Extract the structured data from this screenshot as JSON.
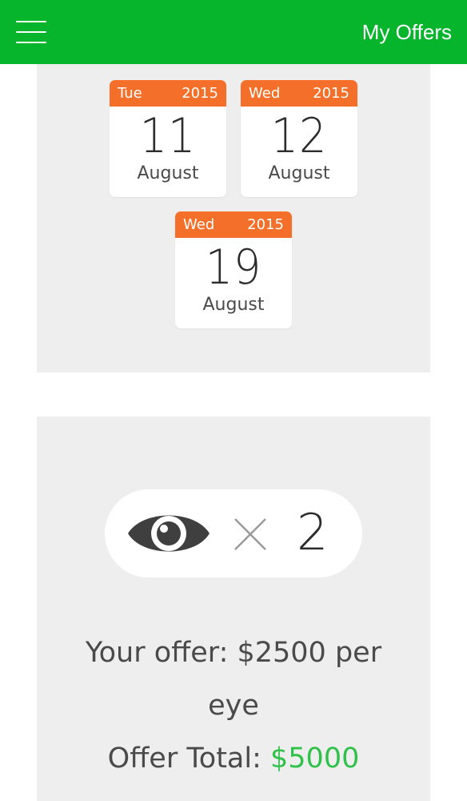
{
  "header": {
    "title": "My Offers",
    "menu_icon": "hamburger-menu-icon",
    "background_color": "#06b52b"
  },
  "dates": [
    {
      "weekday": "Tue",
      "year": "2015",
      "day": "11",
      "month": "August"
    },
    {
      "weekday": "Wed",
      "year": "2015",
      "day": "12",
      "month": "August"
    },
    {
      "weekday": "Wed",
      "year": "2015",
      "day": "19",
      "month": "August"
    }
  ],
  "offer": {
    "eye_icon": "eye-icon",
    "times_icon": "times-icon",
    "eye_count": "2",
    "offer_line_1": "Your offer: $2500 per",
    "offer_line_2": "eye",
    "total_label": "Offer Total: ",
    "total_amount": "$5000",
    "total_color": "#2fc14a"
  },
  "colors": {
    "card_header": "#f4702a",
    "panel_background": "#eeeeef"
  }
}
